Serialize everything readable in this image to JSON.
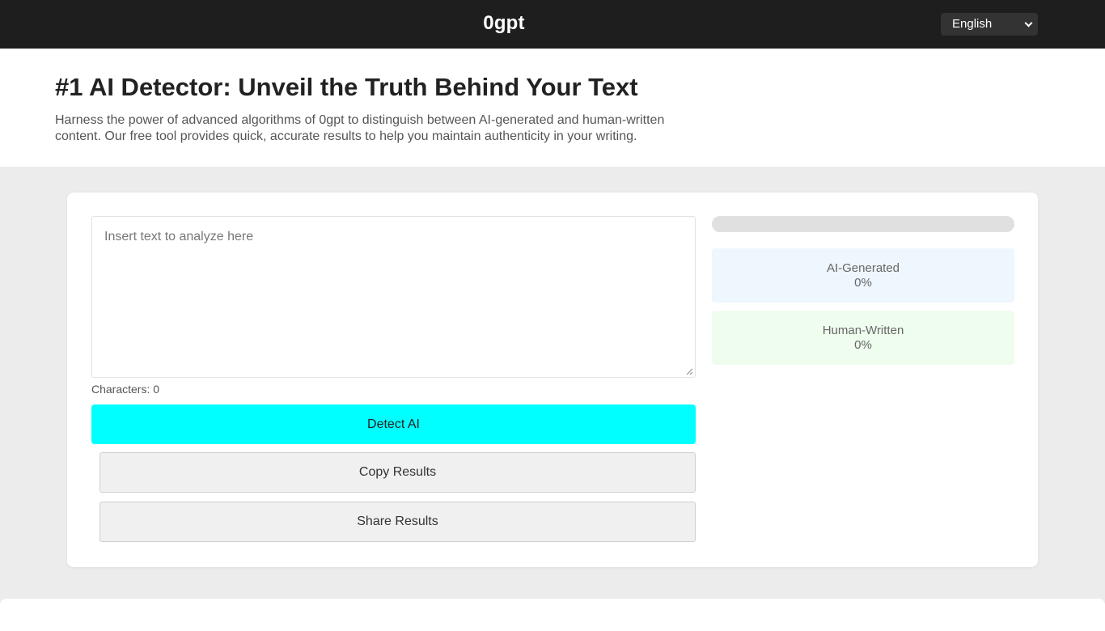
{
  "header": {
    "brand": "0gpt",
    "language": "English"
  },
  "hero": {
    "title": "#1 AI Detector: Unveil the Truth Behind Your Text",
    "description": "Harness the power of advanced algorithms of 0gpt to distinguish between AI-generated and human-written content. Our free tool provides quick, accurate results to help you maintain authenticity in your writing."
  },
  "editor": {
    "placeholder": "Insert text to analyze here",
    "char_count": "Characters: 0"
  },
  "actions": {
    "detect": "Detect AI",
    "copy": "Copy Results",
    "share": "Share Results"
  },
  "results": {
    "progress": 0,
    "ai_label": "AI-Generated",
    "ai_value": "0%",
    "human_label": "Human-Written",
    "human_value": "0%"
  },
  "colors": {
    "accent": "#00ffff",
    "header_bg": "#1e1e1e"
  }
}
